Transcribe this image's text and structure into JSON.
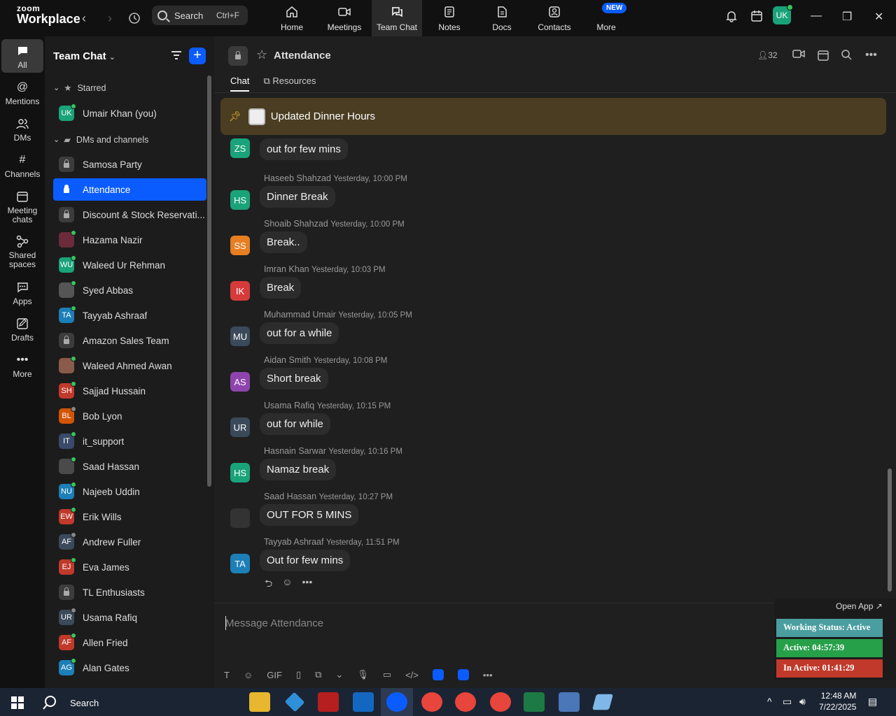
{
  "app": {
    "brand_top": "zoom",
    "brand_bottom": "Workplace",
    "search_label": "Search",
    "search_shortcut": "Ctrl+F",
    "tabs": [
      {
        "label": "Home",
        "icon": "home-icon"
      },
      {
        "label": "Meetings",
        "icon": "video-icon"
      },
      {
        "label": "Team Chat",
        "icon": "chat-icon"
      },
      {
        "label": "Notes",
        "icon": "notes-icon"
      },
      {
        "label": "Docs",
        "icon": "docs-icon"
      },
      {
        "label": "Contacts",
        "icon": "contacts-icon"
      },
      {
        "label": "More",
        "icon": "more-icon"
      }
    ],
    "new_badge": "NEW",
    "user_initials": "UK"
  },
  "rail": [
    {
      "label": "All",
      "icon": "chat-bubble-icon"
    },
    {
      "label": "Mentions",
      "icon": "at-icon"
    },
    {
      "label": "DMs",
      "icon": "people-icon"
    },
    {
      "label": "Channels",
      "icon": "hash-icon"
    },
    {
      "label": "Meeting chats",
      "icon": "calendar-icon"
    },
    {
      "label": "Shared spaces",
      "icon": "share-icon"
    },
    {
      "label": "Apps",
      "icon": "apps-icon"
    },
    {
      "label": "Drafts",
      "icon": "drafts-icon"
    },
    {
      "label": "More",
      "icon": "ellipsis-icon"
    }
  ],
  "sidebar": {
    "title": "Team Chat",
    "starred_label": "Starred",
    "dms_label": "DMs and channels",
    "starred": [
      {
        "name": "Umair Khan (you)",
        "initials": "UK",
        "color": "#1aa37a",
        "type": "user"
      }
    ],
    "items": [
      {
        "name": "Samosa Party",
        "type": "channel"
      },
      {
        "name": "Attendance",
        "type": "channel",
        "active": true
      },
      {
        "name": "Discount & Stock Reservati...",
        "type": "channel"
      },
      {
        "name": "Hazama Nazir",
        "initials": "",
        "color": "#6b2b3a",
        "type": "user"
      },
      {
        "name": "Waleed Ur Rehman",
        "initials": "WU",
        "color": "#1aa37a",
        "type": "user"
      },
      {
        "name": "Syed Abbas",
        "initials": "",
        "color": "#555555",
        "type": "user"
      },
      {
        "name": "Tayyab Ashraaf",
        "initials": "TA",
        "color": "#1c7fb8",
        "type": "user"
      },
      {
        "name": "Amazon Sales Team",
        "type": "channel"
      },
      {
        "name": "Waleed Ahmed Awan",
        "initials": "",
        "color": "#8a5a4a",
        "type": "user"
      },
      {
        "name": "Sajjad Hussain",
        "initials": "SH",
        "color": "#c0392b",
        "type": "user"
      },
      {
        "name": "Bob Lyon",
        "initials": "BL",
        "color": "#d35400",
        "type": "user",
        "away": true
      },
      {
        "name": "it_support",
        "initials": "IT",
        "color": "#3a4a6a",
        "type": "user"
      },
      {
        "name": "Saad Hassan",
        "initials": "",
        "color": "#4a4a4a",
        "type": "user"
      },
      {
        "name": "Najeeb Uddin",
        "initials": "NU",
        "color": "#1c7fb8",
        "type": "user"
      },
      {
        "name": "Erik Wills",
        "initials": "EW",
        "color": "#c0392b",
        "type": "user"
      },
      {
        "name": "Andrew Fuller",
        "initials": "AF",
        "color": "#3a4a5a",
        "type": "user",
        "away": true
      },
      {
        "name": "Eva James",
        "initials": "EJ",
        "color": "#c0392b",
        "type": "user"
      },
      {
        "name": "TL Enthusiasts",
        "type": "channel"
      },
      {
        "name": "Usama Rafiq",
        "initials": "UR",
        "color": "#3a4a5a",
        "type": "user",
        "away": true
      },
      {
        "name": "Allen Fried",
        "initials": "AF",
        "color": "#c0392b",
        "type": "user"
      },
      {
        "name": "Alan Gates",
        "initials": "AG",
        "color": "#1c7fb8",
        "type": "user"
      }
    ]
  },
  "channel": {
    "title": "Attendance",
    "members": "32",
    "tabs": [
      "Chat",
      "Resources"
    ],
    "pinned": "Updated Dinner Hours",
    "compose_placeholder": "Message Attendance"
  },
  "messages": [
    {
      "sender": "",
      "time": "",
      "text": "out for few mins",
      "initials": "ZS",
      "color": "#1aa37a"
    },
    {
      "sender": "Haseeb Shahzad",
      "time": "Yesterday, 10:00 PM",
      "text": "Dinner Break",
      "initials": "HS",
      "color": "#1aa37a"
    },
    {
      "sender": "Shoaib Shahzad",
      "time": "Yesterday, 10:00 PM",
      "text": "Break..",
      "initials": "SS",
      "color": "#e67e22"
    },
    {
      "sender": "Imran Khan",
      "time": "Yesterday, 10:03 PM",
      "text": "Break",
      "initials": "IK",
      "color": "#d63b3b"
    },
    {
      "sender": "Muhammad Umair",
      "time": "Yesterday, 10:05 PM",
      "text": "out for a while",
      "initials": "MU",
      "color": "#3a4a5a"
    },
    {
      "sender": "Aidan Smith",
      "time": "Yesterday, 10:08 PM",
      "text": "Short break",
      "initials": "AS",
      "color": "#8e44ad"
    },
    {
      "sender": "Usama Rafiq",
      "time": "Yesterday, 10:15 PM",
      "text": "out for while",
      "initials": "UR",
      "color": "#3a4a5a"
    },
    {
      "sender": "Hasnain Sarwar",
      "time": "Yesterday, 10:16 PM",
      "text": "Namaz break",
      "initials": "HS",
      "color": "#1aa37a"
    },
    {
      "sender": "Saad Hassan",
      "time": "Yesterday, 10:27 PM",
      "text": "OUT FOR 5 MINS",
      "initials": "",
      "color": "#333333"
    },
    {
      "sender": "Tayyab Ashraaf",
      "time": "Yesterday, 11:51 PM",
      "text": "Out for few mins",
      "initials": "TA",
      "color": "#1c7fb8"
    }
  ],
  "compose_tools": [
    "T",
    "☺",
    "GIF",
    "▯",
    "⧉",
    "⌄",
    "🎙",
    "▭",
    "</>",
    "",
    "",
    "•••"
  ],
  "status_overlay": {
    "open_app": "Open App ↗",
    "working": "Working Status: Active",
    "active": "Active: 04:57:39",
    "inactive": "In Active: 01:41:29",
    "colors": {
      "working": "#4a9ea0",
      "active": "#27a04a",
      "inactive": "#c0392b"
    }
  },
  "taskbar": {
    "search": "Search",
    "time": "12:48 AM",
    "date": "7/22/2025"
  }
}
